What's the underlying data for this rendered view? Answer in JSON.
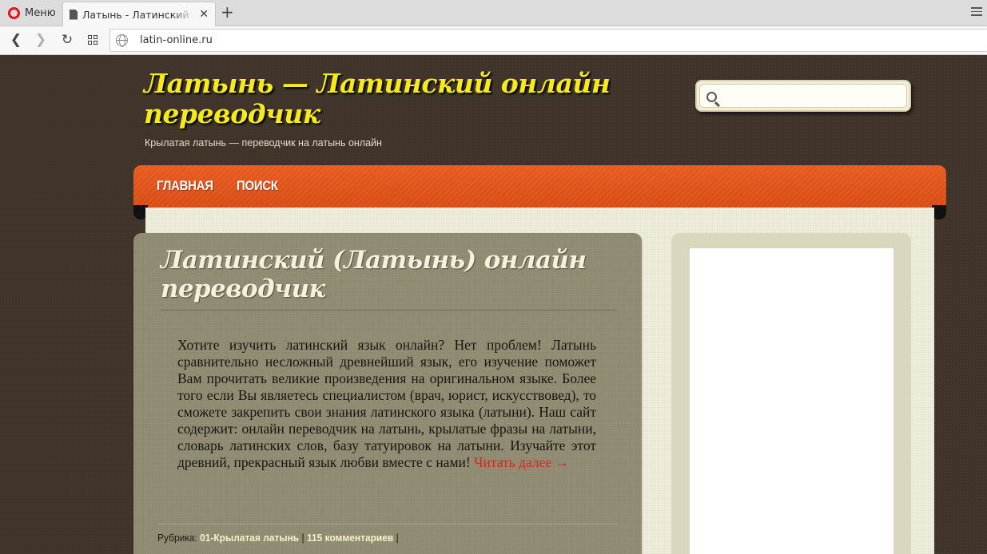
{
  "browser": {
    "menu_label": "Меню",
    "tab_title": "Латынь - Латинский онлайн переводчик",
    "tab_close": "✕",
    "new_tab": "+",
    "url": "latin-online.ru"
  },
  "site": {
    "title": "Латынь — Латинский онлайн переводчик",
    "tagline": "Крылатая латынь — переводчик на латынь онлайн",
    "search_placeholder": ""
  },
  "nav": {
    "items": [
      "ГЛАВНАЯ",
      "ПОИСК"
    ]
  },
  "post": {
    "title": "Латинский (Латынь) онлайн переводчик",
    "body": "Хотите изучить латинский язык онлайн? Нет проблем! Латынь сравнительно несложный древнейший язык, его изучение поможет Вам прочитать великие произведения на оригинальном языке. Более того если Вы являетесь специалистом (врач, юрист, искусствовед), то сможете закрепить свои знания латинского языка (латыни). Наш сайт содержит: онлайн переводчик на латынь, крылатые фразы на латыни, словарь латинских слов, базу татуировок на латыни. Изучайте этот древний, прекрасный язык любви вместе с нами!",
    "read_more": "Читать далее →",
    "meta": {
      "category_label": "Рубрика:",
      "category": "01-Крылатая латынь",
      "separator": "|",
      "comments": "115 комментариев",
      "trailing_separator": "|"
    }
  },
  "colors": {
    "title": "#f6ea19",
    "nav": "#e2531a",
    "link": "#d32a1a",
    "page_bg": "#3f342a",
    "post_bg": "#8e8a71"
  }
}
